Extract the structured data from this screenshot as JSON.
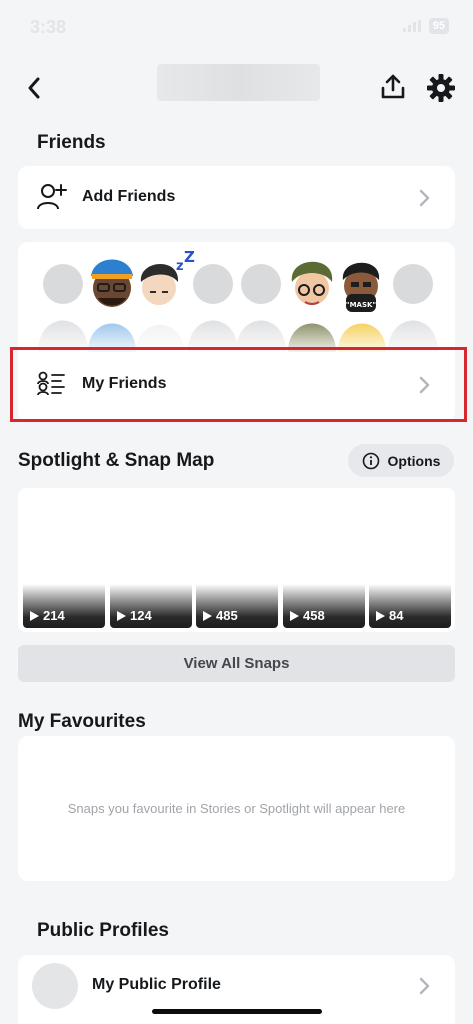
{
  "status": {
    "time": "3:38",
    "battery": "95"
  },
  "friends": {
    "title": "Friends",
    "add_friends_label": "Add Friends",
    "my_friends_label": "My Friends"
  },
  "spotlight": {
    "title": "Spotlight & Snap Map",
    "options_label": "Options",
    "snaps": [
      {
        "count": "214"
      },
      {
        "count": "124"
      },
      {
        "count": "485"
      },
      {
        "count": "458"
      },
      {
        "count": "84"
      }
    ],
    "view_all_label": "View All Snaps"
  },
  "favourites": {
    "title": "My Favourites",
    "empty_text": "Snaps you favourite in Stories or Spotlight will appear here"
  },
  "public_profiles": {
    "title": "Public Profiles",
    "my_public_profile_label": "My Public Profile"
  },
  "colors": {
    "background": "#f4f5f6",
    "card": "#ffffff",
    "highlight": "#d8262f",
    "chevron": "#b4b8bd"
  },
  "icons": {
    "back": "chevron-left-icon",
    "share": "share-icon",
    "settings": "gear-icon",
    "add_friends": "add-friend-icon",
    "my_friends": "friends-list-icon",
    "options": "info-icon",
    "play": "play-icon",
    "row_chevron": "chevron-right-icon"
  }
}
